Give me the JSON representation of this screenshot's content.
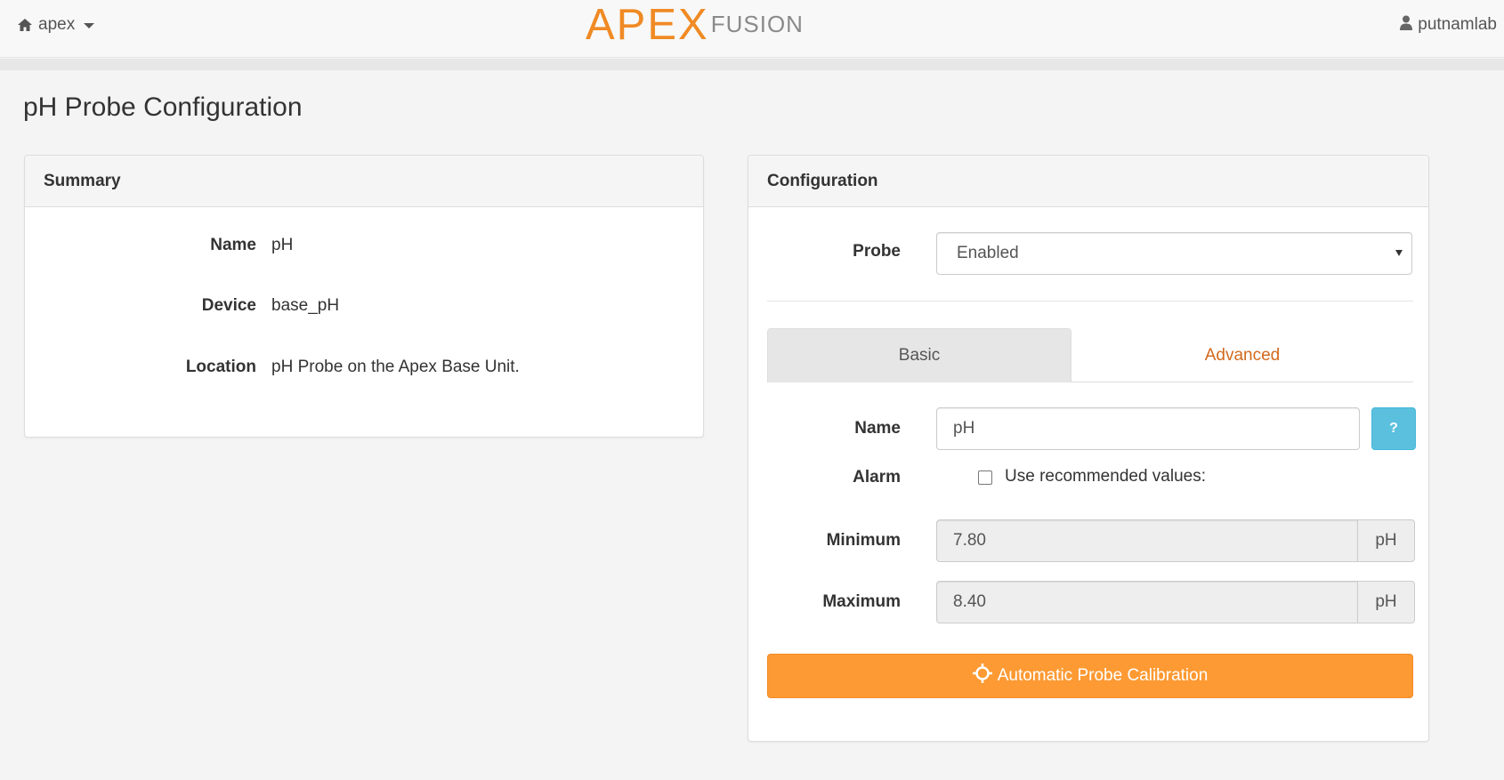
{
  "navbar": {
    "home_label": "apex",
    "logo_main": "APEX",
    "logo_sub": "FUSION",
    "user_label": "putnamlab",
    "icons": {
      "home": "home-icon",
      "user": "user-icon"
    }
  },
  "page": {
    "title": "pH Probe Configuration"
  },
  "summary": {
    "heading": "Summary",
    "rows": [
      {
        "label": "Name",
        "value": "pH"
      },
      {
        "label": "Device",
        "value": "base_pH"
      },
      {
        "label": "Location",
        "value": "pH Probe on the Apex Base Unit."
      }
    ]
  },
  "configuration": {
    "heading": "Configuration",
    "probe_label": "Probe",
    "probe_value": "Enabled",
    "tabs": [
      {
        "label": "Basic",
        "active": true
      },
      {
        "label": "Advanced",
        "active": false
      }
    ],
    "name_label": "Name",
    "name_value": "pH",
    "help_label": "?",
    "alarm_label": "Alarm",
    "alarm_checkbox_label": "Use recommended values:",
    "alarm_checked": false,
    "minimum_label": "Minimum",
    "minimum_value": "7.80",
    "minimum_unit": "pH",
    "maximum_label": "Maximum",
    "maximum_value": "8.40",
    "maximum_unit": "pH",
    "calibration_button": "Automatic Probe Calibration"
  },
  "colors": {
    "accent": "#fd9a33",
    "logo_orange": "#f08a24",
    "tab_link": "#d2691e",
    "help_button": "#5bc0de"
  }
}
